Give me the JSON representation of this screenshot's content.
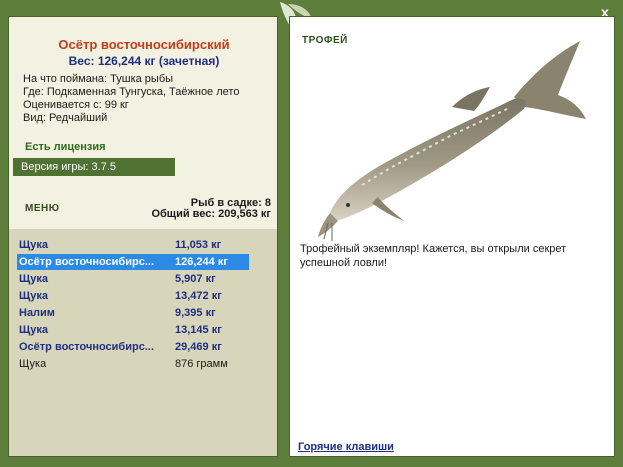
{
  "close_label": "x",
  "left": {
    "title": "Осётр восточносибирский",
    "weight": "Вес: 126,244 кг (зачетная)",
    "caught_on": "На что поймана: Тушка рыбы",
    "where": "Где: Подкаменная Тунгуска, Таёжное лето",
    "value": "Оценивается с: 99 кг",
    "kind": "Вид: Редчайший",
    "license": "Есть лицензия",
    "version": "Версия игры: 3.7.5",
    "menu": "МЕНЮ",
    "keep_count": "Рыб в садке: 8",
    "keep_total": "Общий вес: 209,563 кг",
    "catches": [
      {
        "name": "Щука",
        "weight": "11,053 кг"
      },
      {
        "name": "Осётр восточносибирс...",
        "weight": "126,244 кг"
      },
      {
        "name": "Щука",
        "weight": "5,907 кг"
      },
      {
        "name": "Щука",
        "weight": "13,472 кг"
      },
      {
        "name": "Налим",
        "weight": "9,395 кг"
      },
      {
        "name": "Щука",
        "weight": "13,145 кг"
      },
      {
        "name": "Осётр восточносибирс...",
        "weight": "29,469 кг"
      },
      {
        "name": "Щука",
        "weight": "876 грамм"
      }
    ]
  },
  "right": {
    "heading": "ТРОФЕЙ",
    "description": "Трофейный экземпляр! Кажется, вы открыли секрет успешной ловли!",
    "hotkeys": "Горячие клавиши"
  },
  "colors": {
    "frame": "#5e7f3c",
    "panel": "#f3f1e1",
    "list_bg": "#d8d6ba",
    "selected": "#2b8ae6",
    "title": "#c0401a",
    "link": "#1f2f80"
  }
}
